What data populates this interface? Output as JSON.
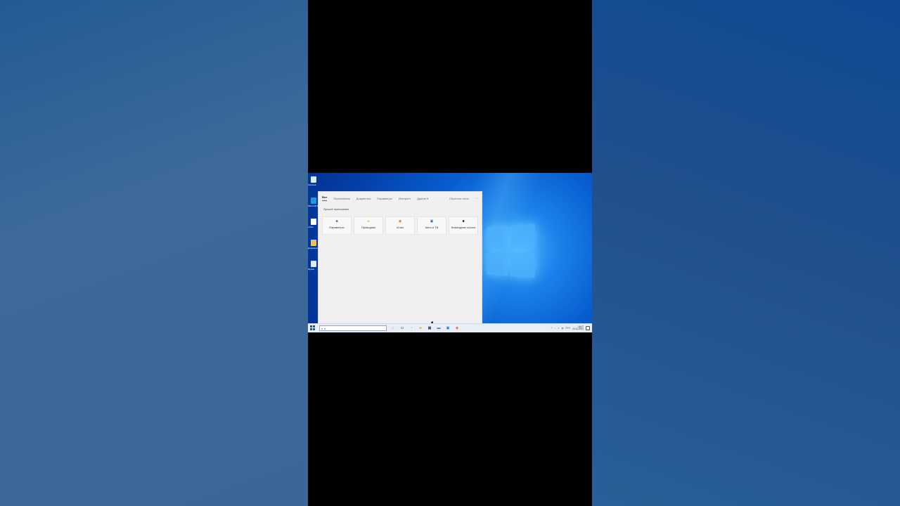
{
  "theme": {
    "accent": "#0b78d7",
    "desktop_blue": "#0a66d8",
    "panel_bg": "#f0f0f0"
  },
  "desktop": {
    "icons": [
      {
        "name": "recycle-bin-icon",
        "label": "Корзина"
      },
      {
        "name": "edge-icon",
        "label": "Microsoft Edge"
      },
      {
        "name": "ocam-icon",
        "label": "oCam"
      },
      {
        "name": "folder-icon",
        "label": "Документы"
      },
      {
        "name": "app-icon",
        "label": "Ярлык"
      }
    ]
  },
  "search_panel": {
    "tabs": [
      "Все",
      "Приложения",
      "Документы",
      "Параметры",
      "Интернет",
      "Другие ▾"
    ],
    "feedback": "Обратная связь",
    "more": "···",
    "best_apps_title": "Лучшие приложения",
    "apps": [
      {
        "label": "Параметры",
        "icon": "settings-icon",
        "glyph": "■",
        "color": "#1e6fd9"
      },
      {
        "label": "Проводник",
        "icon": "folder-icon",
        "glyph": "▰",
        "color": "#f2c14e"
      },
      {
        "label": "oCam",
        "icon": "camera-icon",
        "glyph": "◉",
        "color": "#e86a2b"
      },
      {
        "label": "Кино и ТВ",
        "icon": "movies-icon",
        "glyph": "▣",
        "color": "#1e6fd9"
      },
      {
        "label": "Командная строка",
        "icon": "terminal-icon",
        "glyph": "■",
        "color": "#111111"
      }
    ]
  },
  "taskbar": {
    "search_glyph": "⌕",
    "search_value": "к",
    "icons": [
      {
        "name": "task-view-icon",
        "glyph": "◌"
      },
      {
        "name": "widgets-icon",
        "glyph": "▭"
      },
      {
        "name": "edge-icon",
        "glyph": "◔"
      },
      {
        "name": "explorer-icon",
        "glyph": "▰"
      },
      {
        "name": "store-icon",
        "glyph": "▦"
      },
      {
        "name": "mail-icon",
        "glyph": "▬"
      },
      {
        "name": "movies-icon",
        "glyph": "▣"
      },
      {
        "name": "ocam-icon",
        "glyph": "◉"
      }
    ],
    "tray": [
      "^",
      "⌂",
      "◐",
      "◍",
      "РУС"
    ],
    "time": "16:07",
    "date": "24.11.2021"
  }
}
